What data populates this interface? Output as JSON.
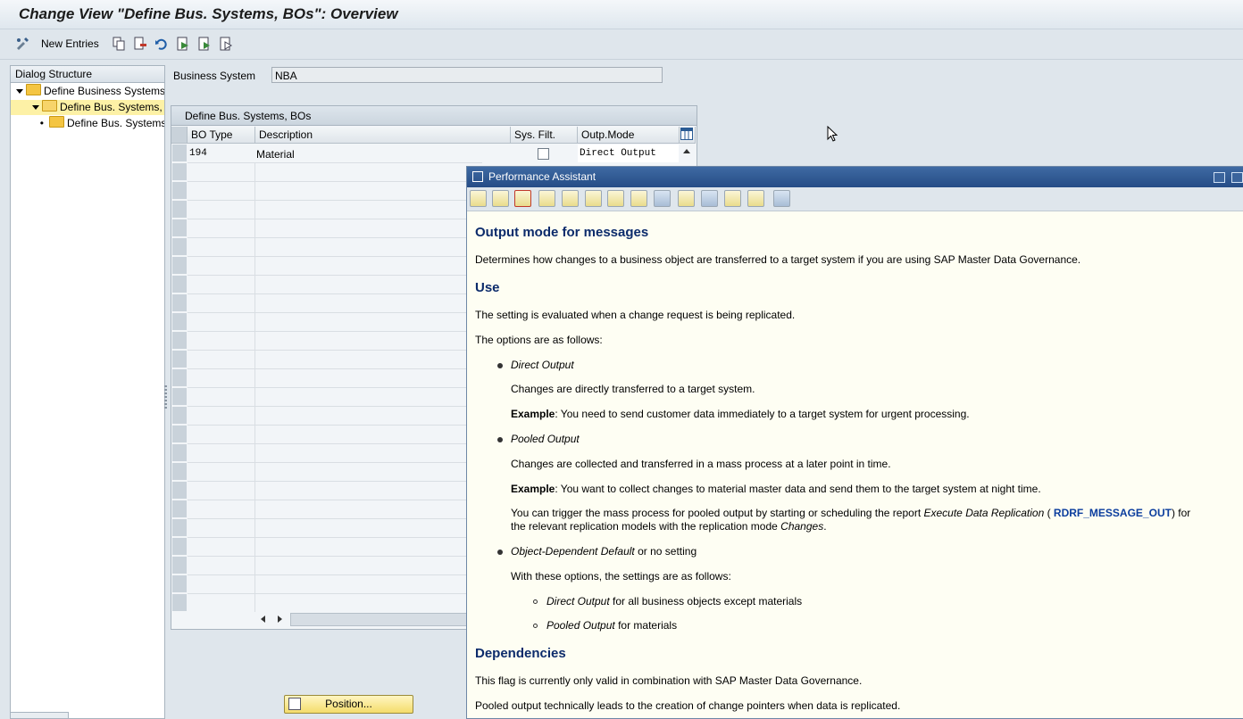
{
  "window": {
    "title": "Change View \"Define Bus. Systems,  BOs\": Overview"
  },
  "toolbar": {
    "new_entries": "New Entries"
  },
  "dialog_structure": {
    "header": "Dialog Structure",
    "items": [
      {
        "label": "Define Business Systems"
      },
      {
        "label": "Define Bus. Systems, BOs"
      },
      {
        "label": "Define Bus. Systems"
      }
    ]
  },
  "form": {
    "business_system_label": "Business System",
    "business_system_value": "NBA"
  },
  "table": {
    "caption": "Define Bus. Systems,  BOs",
    "columns": [
      "BO Type",
      "Description",
      "Sys. Filt.",
      "Outp.Mode"
    ],
    "rows": [
      {
        "bo_type": "194",
        "description": "Material",
        "sys_filt": false,
        "outp_mode": "Direct Output"
      }
    ]
  },
  "position_button": "Position...",
  "performance_assistant": {
    "title": "Performance Assistant",
    "h_output_mode": "Output mode for messages",
    "p_determines": "Determines how changes to a business object are transferred to a target system if you are using SAP Master Data Governance.",
    "h_use": "Use",
    "p_setting": "The setting is evaluated when a change request is being replicated.",
    "p_options": "The options are as follows:",
    "direct_output": "Direct Output",
    "p_direct_desc": "Changes are directly transferred to a target system.",
    "example_label": "Example",
    "p_direct_example": ": You need to send customer data immediately to a target system for urgent processing.",
    "pooled_output": "Pooled Output",
    "p_pooled_desc": "Changes are collected and transferred in a mass process at a later point in time.",
    "p_pooled_example": ": You want to collect changes to material master data and send them to the target system at night time.",
    "p_trigger_1": "You can trigger the mass process for pooled output by starting or scheduling the report ",
    "report_name": "Execute Data Replication",
    "p_trigger_2": " ( ",
    "report_code": "RDRF_MESSAGE_OUT",
    "p_trigger_3": ") for",
    "p_trigger_4": "the relevant replication models with the replication mode ",
    "changes_word": "Changes",
    "p_trigger_5": ".",
    "object_default": "Object-Dependent Default",
    "or_no_setting": " or no setting",
    "p_with_these": "With these options, the settings are as follows:",
    "sub_direct_rest": " for all business objects except materials",
    "sub_pooled_rest": " for materials",
    "h_dependencies": "Dependencies",
    "p_flag": "This flag is currently only valid in combination with SAP Master Data Governance.",
    "p_pooled_tech": "Pooled output technically leads to the creation of change pointers when data is replicated."
  },
  "colors": {
    "accent": "#0c2b6b",
    "selection": "#fdf1a6",
    "pa_background": "#fefef3"
  }
}
